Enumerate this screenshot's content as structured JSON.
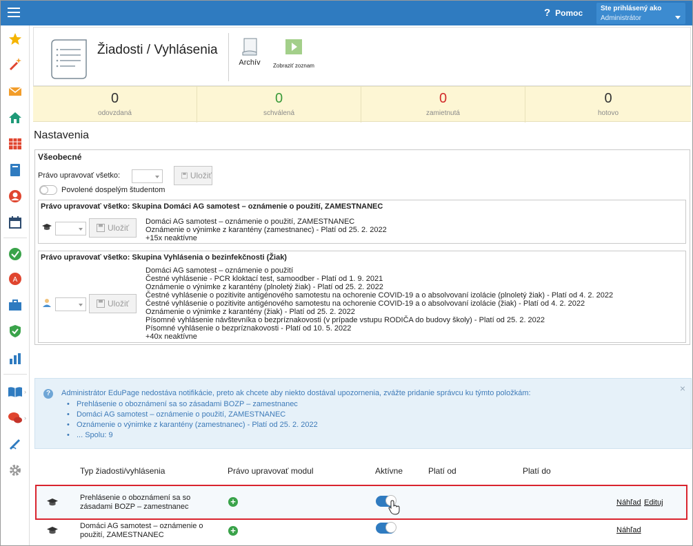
{
  "topbar": {
    "help_label": "Pomoc",
    "user_label": "Ste prihlásený ako",
    "user_name": "Administrátor"
  },
  "sidebar": {
    "icons": [
      "star-icon",
      "magic-wand-icon",
      "mail-icon",
      "home-icon",
      "timetable-icon",
      "book-icon",
      "user-icon",
      "calendar-icon",
      "check-icon",
      "badge-icon",
      "briefcase-icon",
      "shield-icon",
      "chart-icon",
      "reading-book-icon",
      "chat-icon",
      "pen-icon",
      "gear-icon"
    ]
  },
  "header": {
    "title": "Žiadosti / Vyhlásenia",
    "archive_label": "Archív",
    "show_list_label": "Zobraziť zoznam"
  },
  "stats": [
    {
      "value": "0",
      "label": "odovzdaná",
      "color": "#333333"
    },
    {
      "value": "0",
      "label": "schválená",
      "color": "#3a9a3a"
    },
    {
      "value": "0",
      "label": "zamietnutá",
      "color": "#d22b2b"
    },
    {
      "value": "0",
      "label": "hotovo",
      "color": "#333333"
    }
  ],
  "settings": {
    "title": "Nastavenia",
    "general": {
      "title": "Všeobecné",
      "edit_all_label": "Právo upravovať všetko:",
      "save_label": "Uložiť",
      "adult_students_label": "Povolené dospelým študentom"
    },
    "group1": {
      "title": "Právo upravovať všetko: Skupina Domáci AG samotest – oznámenie o použití, ZAMESTNANEC",
      "save_label": "Uložiť",
      "lines": [
        "Domáci AG samotest – oznámenie o použití, ZAMESTNANEC",
        "Oznámenie o výnimke z karantény (zamestnanec) - Platí od 25. 2. 2022",
        "+15x neaktívne"
      ]
    },
    "group2": {
      "title": "Právo upravovať všetko: Skupina Vyhlásenia o bezinfekčnosti (Žiak)",
      "save_label": "Uložiť",
      "lines": [
        "Domáci AG samotest – oznámenie o použití",
        "Čestné vyhlásenie - PCR kloktací test, samoodber - Platí od 1. 9. 2021",
        "Oznámenie o výnimke z karantény (plnoletý žiak) - Platí od 25. 2. 2022",
        "Čestné vyhlásenie o pozitivite antigénového samotestu na ochorenie COVID-19 a o absolvovaní izolácie (plnoletý žiak) - Platí od 4. 2. 2022",
        "Čestné vyhlásenie o pozitivite antigénového samotestu na ochorenie COVID-19 a o absolvovaní izolácie (žiak) - Platí od 4. 2. 2022",
        "Oznámenie o výnimke z karantény (žiak) - Platí od 25. 2. 2022",
        "Písomné vyhlásenie návštevníka o bezpríznakovosti (v prípade vstupu RODIČA do budovy školy) - Platí od 25. 2. 2022",
        "Písomné vyhlásenie o bezpríznakovosti - Platí od 10. 5. 2022",
        "+40x neaktívne"
      ]
    }
  },
  "notice": {
    "message": "Administrátor EduPage nedostáva notifikácie, preto ak chcete aby niekto dostával upozornenia, zvážte pridanie správcu ku týmto položkám:",
    "items": [
      "Prehlásenie o oboznámení sa so zásadami BOZP – zamestnanec",
      "Domáci AG samotest – oznámenie o použití, ZAMESTNANEC",
      "Oznámenie o výnimke z karantény (zamestnanec) - Platí od 25. 2. 2022",
      "... Spolu: 9"
    ],
    "close": "×"
  },
  "table": {
    "headers": {
      "type": "Typ žiadosti/vyhlásenia",
      "right": "Právo upravovať modul",
      "active": "Aktívne",
      "valid_from": "Platí od",
      "valid_to": "Platí do"
    },
    "rows": [
      {
        "name_l1": "Prehlásenie o oboznámení sa so",
        "name_l2": "zásadami BOZP – zamestnanec",
        "preview": "Náhľad",
        "edit": "Edituj",
        "active": true
      },
      {
        "name_l1": "Domáci AG samotest – oznámenie o",
        "name_l2": "použití, ZAMESTNANEC",
        "preview": "Náhľad",
        "active": true
      }
    ]
  }
}
